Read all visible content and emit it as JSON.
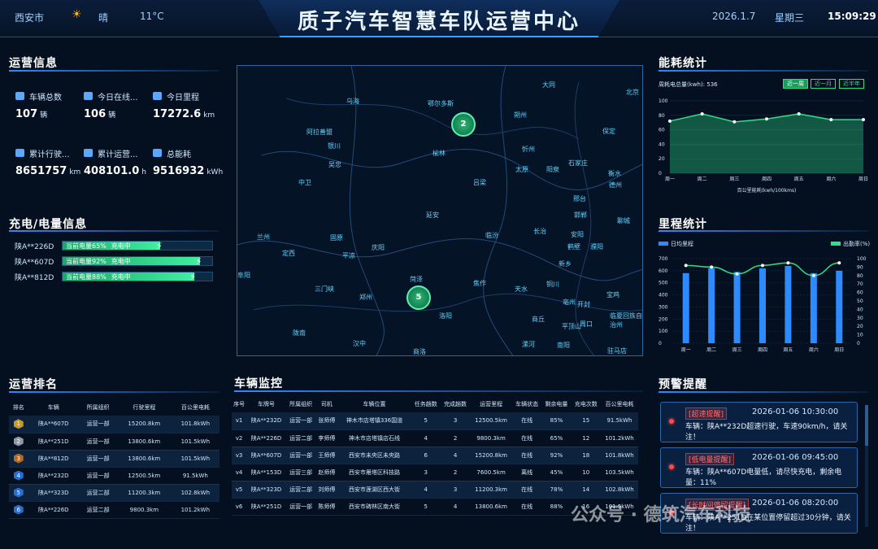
{
  "header": {
    "city": "西安市",
    "weather": "晴",
    "temp": "11°C",
    "title": "质子汽车智慧车队运营中心",
    "date": "2026.1.7",
    "weekday": "星期三",
    "time": "15:09:29"
  },
  "ops": {
    "title": "运营信息",
    "stats": [
      {
        "label": "车辆总数",
        "value": "107",
        "unit": "辆"
      },
      {
        "label": "今日在线...",
        "value": "106",
        "unit": "辆"
      },
      {
        "label": "今日里程",
        "value": "17272.6",
        "unit": "km"
      },
      {
        "label": "累计行驶...",
        "value": "8651757",
        "unit": "km"
      },
      {
        "label": "累计运营...",
        "value": "408101.0",
        "unit": "h"
      },
      {
        "label": "总能耗",
        "value": "9516932",
        "unit": "kWh"
      }
    ]
  },
  "charge": {
    "title": "充电/电量信息",
    "items": [
      {
        "plate": "陕A**226D",
        "text": "当前电量65%",
        "status": "充电中",
        "level": 0.65
      },
      {
        "plate": "陕A**607D",
        "text": "当前电量92%",
        "status": "充电中",
        "level": 0.92
      },
      {
        "plate": "陕A**812D",
        "text": "当前电量88%",
        "status": "充电中",
        "level": 0.88
      }
    ]
  },
  "map": {
    "clusters": [
      "2",
      "5"
    ],
    "cities": [
      "大同",
      "北京",
      "乌海",
      "鄂尔多斯",
      "朔州",
      "保定",
      "阿拉善盟",
      "银川",
      "忻州",
      "吴忠",
      "榆林",
      "太原",
      "阳泉",
      "石家庄",
      "衡水",
      "中卫",
      "吕梁",
      "德州",
      "邢台",
      "邯郸",
      "延安",
      "聊城",
      "兰州",
      "固原",
      "临汾",
      "长治",
      "安阳",
      "定西",
      "平凉",
      "庆阳",
      "鹤壁",
      "濮阳",
      "新乡",
      "菏泽",
      "焦作",
      "铜川",
      "三门峡",
      "郑州",
      "天水",
      "宝鸡",
      "洛阳",
      "商丘",
      "平顶山",
      "周口",
      "陇南",
      "汉中",
      "商洛",
      "漯河",
      "南阳",
      "驻马店",
      "阜阳",
      "临夏回族自治州",
      "亳州",
      "开封"
    ]
  },
  "energy": {
    "title": "能耗统计",
    "summary": "周耗电总量(kwh): 536",
    "tabs": [
      "近一周",
      "近一月",
      "近半年"
    ],
    "xlabel": "百公里能耗(kwh/100kms)"
  },
  "mileage": {
    "title": "里程统计",
    "legend_left": "日均里程",
    "legend_right": "出勤率(%)"
  },
  "chart_data": [
    {
      "type": "area",
      "categories": [
        "周一",
        "周二",
        "周三",
        "周四",
        "周五",
        "周六",
        "周日"
      ],
      "values": [
        72,
        82,
        71,
        75,
        82,
        74,
        74
      ],
      "ylim": [
        0,
        100
      ],
      "xlabel": "百公里能耗(kwh/100kms)"
    },
    {
      "type": "bar",
      "categories": [
        "周一",
        "周二",
        "周三",
        "周四",
        "周五",
        "周六",
        "周日"
      ],
      "series": [
        {
          "name": "日均里程",
          "values": [
            580,
            620,
            590,
            620,
            640,
            580,
            600
          ]
        },
        {
          "name": "出勤率(%)",
          "values": [
            92,
            90,
            82,
            92,
            95,
            80,
            95
          ]
        }
      ],
      "ylim": [
        0,
        700
      ],
      "y2lim": [
        0,
        100
      ]
    }
  ],
  "ranking": {
    "title": "运营排名",
    "headers": [
      "排名",
      "车辆",
      "所属组织",
      "行驶里程",
      "百公里电耗"
    ],
    "rows": [
      [
        "1",
        "陕A**607D",
        "运营一部",
        "15200.8km",
        "101.8kWh"
      ],
      [
        "2",
        "陕A**251D",
        "运营一部",
        "13800.6km",
        "101.5kWh"
      ],
      [
        "3",
        "陕A**812D",
        "运营一部",
        "13800.6km",
        "101.5kWh"
      ],
      [
        "4",
        "陕A**232D",
        "运营一部",
        "12500.5km",
        "91.5kWh"
      ],
      [
        "5",
        "陕A**323D",
        "运营二部",
        "11200.3km",
        "102.8kWh"
      ],
      [
        "6",
        "陕A**226D",
        "运营二部",
        "9800.3km",
        "101.2kWh"
      ]
    ]
  },
  "monitor": {
    "title": "车辆监控",
    "headers": [
      "序号",
      "车牌号",
      "所属组织",
      "司机",
      "车辆位置",
      "任务趟数",
      "完成趟数",
      "运营里程",
      "车辆状态",
      "剩余电量",
      "充电次数",
      "百公里电耗"
    ],
    "rows": [
      [
        "v1",
        "陕A**232D",
        "运营一部",
        "张师傅",
        "神木市店塔镇336国道",
        "5",
        "3",
        "12500.5km",
        "在线",
        "85%",
        "15",
        "91.5kWh"
      ],
      [
        "v2",
        "陕A**226D",
        "运营二部",
        "李师傅",
        "神木市店塔镇店石线",
        "4",
        "2",
        "9800.3km",
        "在线",
        "65%",
        "12",
        "101.2kWh"
      ],
      [
        "v3",
        "陕A**607D",
        "运营一部",
        "王师傅",
        "西安市未央区未央路",
        "6",
        "4",
        "15200.8km",
        "在线",
        "92%",
        "18",
        "101.8kWh"
      ],
      [
        "v4",
        "陕A**153D",
        "运营三部",
        "赵师傅",
        "西安市雁塔区科技路",
        "3",
        "2",
        "7600.5km",
        "离线",
        "45%",
        "10",
        "103.5kWh"
      ],
      [
        "v5",
        "陕A**323D",
        "运营二部",
        "刘师傅",
        "西安市莲湖区西大街",
        "4",
        "3",
        "11200.3km",
        "在线",
        "78%",
        "14",
        "102.8kWh"
      ],
      [
        "v6",
        "陕A**251D",
        "运营一部",
        "陈师傅",
        "西安市碑林区南大街",
        "5",
        "4",
        "13800.6km",
        "在线",
        "88%",
        "16",
        "101.5kWh"
      ]
    ]
  },
  "alerts": {
    "title": "预警提醒",
    "items": [
      {
        "tag": "[超速提醒]",
        "time": "2026-01-06 10:30:00",
        "msg": "车辆：陕A**232D超速行驶，车速90km/h，请关注！"
      },
      {
        "tag": "[低电量提醒]",
        "time": "2026-01-06 09:45:00",
        "msg": "车辆：陕A**607D电量低，请尽快充电，剩余电量：11%"
      },
      {
        "tag": "[长时间停留提醒]",
        "time": "2026-01-06 08:20:00",
        "msg": "车辆：陕A**251D在某位置停留超过30分钟，请关注！"
      }
    ]
  },
  "watermark": "公众号 · 德筑汽车科技",
  "colors": {
    "accent": "#2e8bff",
    "green": "#2ee08a",
    "alert": "#ff4a4a"
  }
}
